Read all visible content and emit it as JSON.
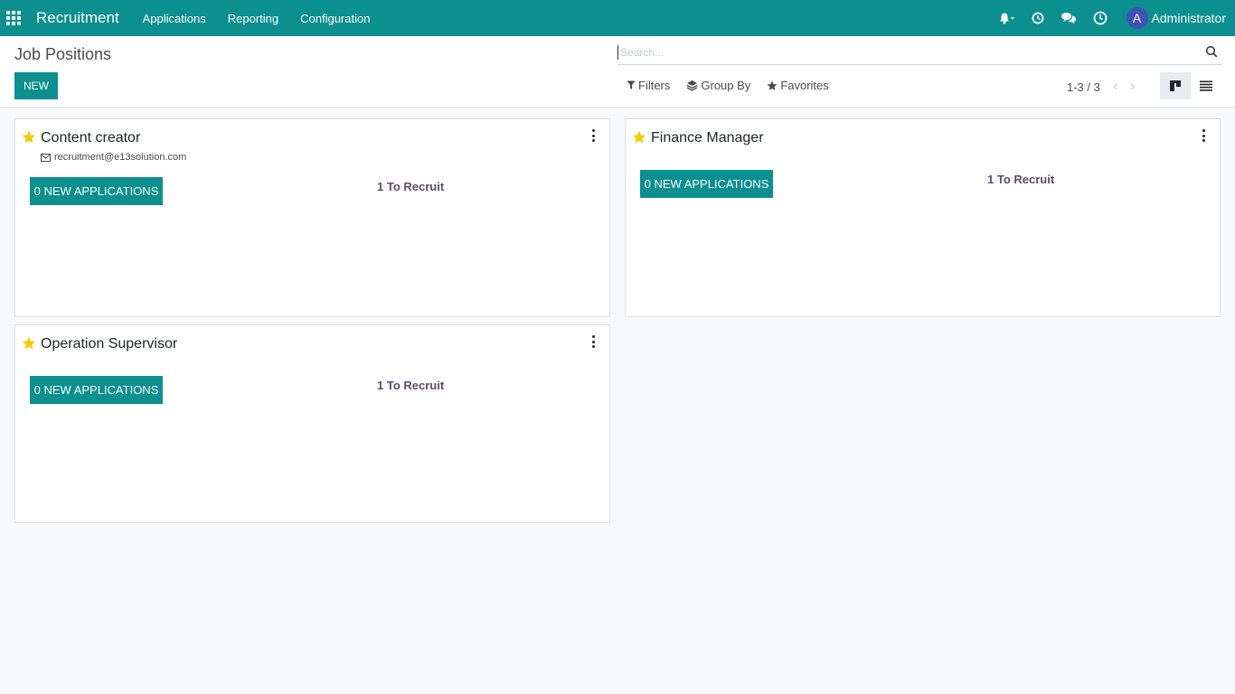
{
  "navbar": {
    "app_name": "Recruitment",
    "menu": [
      "Applications",
      "Reporting",
      "Configuration"
    ],
    "user_initial": "A",
    "user_name": "Administrator"
  },
  "control_panel": {
    "title": "Job Positions",
    "new_label": "NEW",
    "search_placeholder": "Search...",
    "filters_label": "Filters",
    "group_by_label": "Group By",
    "favorites_label": "Favorites",
    "pager": "1-3 / 3"
  },
  "cards": [
    {
      "title": "Content creator",
      "email": "recruitment@e13solution.com",
      "applications_label": "0 NEW APPLICATIONS",
      "to_recruit": "1 To Recruit"
    },
    {
      "title": "Finance Manager",
      "email": "",
      "applications_label": "0 NEW APPLICATIONS",
      "to_recruit": "1 To Recruit"
    },
    {
      "title": "Operation Supervisor",
      "email": "",
      "applications_label": "0 NEW APPLICATIONS",
      "to_recruit": "1 To Recruit"
    }
  ],
  "colors": {
    "brand": "#0b8f8f",
    "star": "#f3cc00",
    "recruit_text": "#5e4a6b"
  },
  "icons": [
    "apps-icon",
    "bell-icon",
    "clock-icon",
    "chat-icon",
    "activity-icon",
    "search-icon",
    "filter-icon",
    "layers-icon",
    "star-icon",
    "kanban-view-icon",
    "list-view-icon",
    "envelope-icon",
    "kebab-menu-icon"
  ]
}
